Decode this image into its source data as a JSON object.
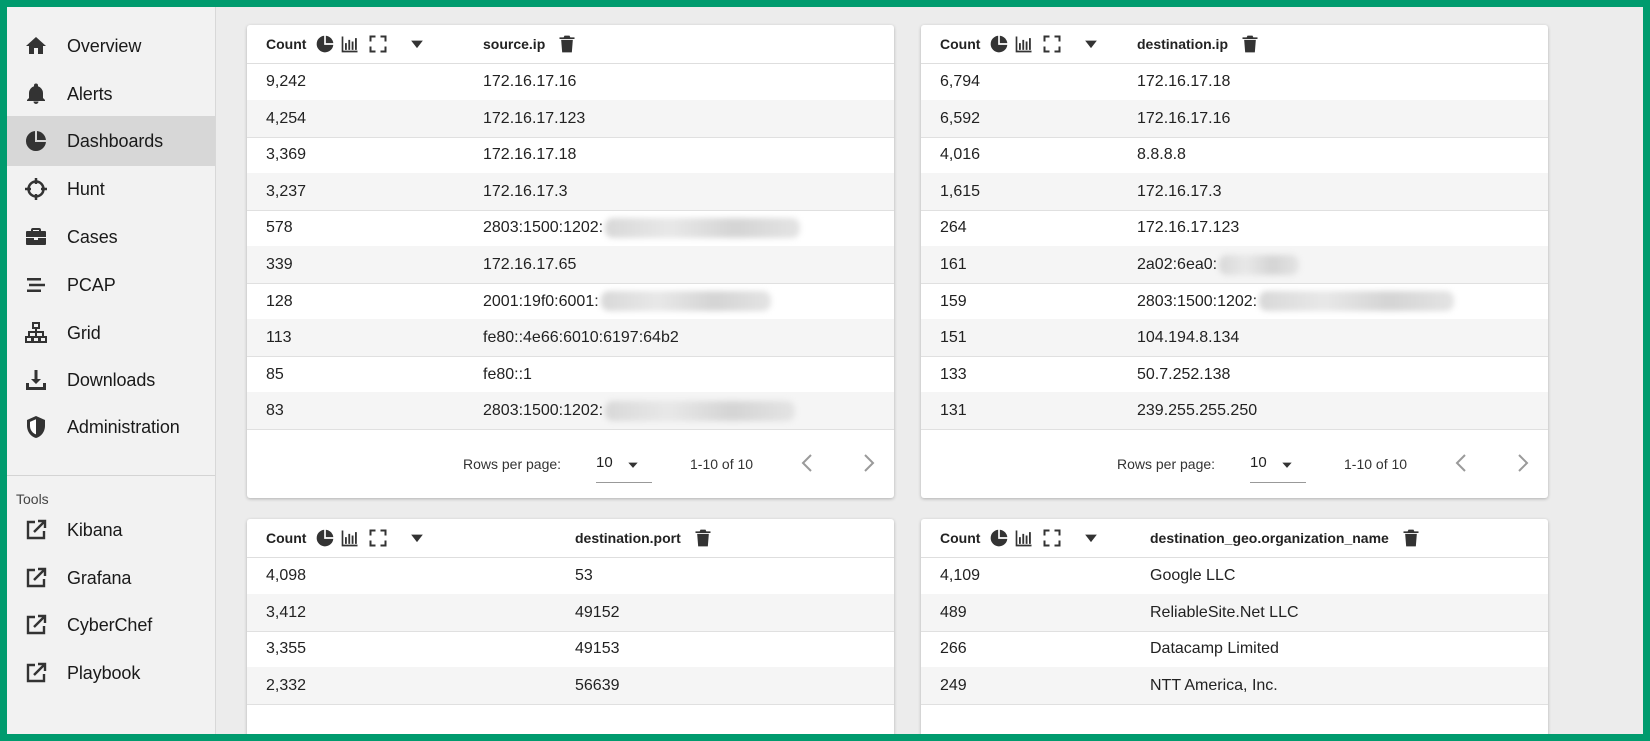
{
  "sidebar": {
    "nav": [
      {
        "label": "Overview",
        "icon": "home-icon",
        "active": false
      },
      {
        "label": "Alerts",
        "icon": "bell-icon",
        "active": false
      },
      {
        "label": "Dashboards",
        "icon": "pie-chart-icon",
        "active": true
      },
      {
        "label": "Hunt",
        "icon": "crosshairs-icon",
        "active": false
      },
      {
        "label": "Cases",
        "icon": "briefcase-icon",
        "active": false
      },
      {
        "label": "PCAP",
        "icon": "stream-icon",
        "active": false
      },
      {
        "label": "Grid",
        "icon": "sitemap-icon",
        "active": false
      },
      {
        "label": "Downloads",
        "icon": "download-icon",
        "active": false
      },
      {
        "label": "Administration",
        "icon": "shield-icon",
        "active": false
      }
    ],
    "tools_heading": "Tools",
    "tools": [
      {
        "label": "Kibana",
        "icon": "external-link-icon"
      },
      {
        "label": "Grafana",
        "icon": "external-link-icon"
      },
      {
        "label": "CyberChef",
        "icon": "external-link-icon"
      },
      {
        "label": "Playbook",
        "icon": "external-link-icon"
      }
    ]
  },
  "tables": [
    {
      "count_header": "Count",
      "field_header": "source.ip",
      "rows": [
        {
          "count": "9,242",
          "value": "172.16.17.16"
        },
        {
          "count": "4,254",
          "value": "172.16.17.123"
        },
        {
          "count": "3,369",
          "value": "172.16.17.18"
        },
        {
          "count": "3,237",
          "value": "172.16.17.3"
        },
        {
          "count": "578",
          "value": "2803:1500:1202:",
          "redacted": true
        },
        {
          "count": "339",
          "value": "172.16.17.65"
        },
        {
          "count": "128",
          "value": "2001:19f0:6001:",
          "redacted": true
        },
        {
          "count": "113",
          "value": "fe80::4e66:6010:6197:64b2"
        },
        {
          "count": "85",
          "value": "fe80::1"
        },
        {
          "count": "83",
          "value": "2803:1500:1202:",
          "redacted": true
        }
      ],
      "footer": {
        "rows_per_page_label": "Rows per page:",
        "rows_per_page": "10",
        "range": "1-10 of 10"
      }
    },
    {
      "count_header": "Count",
      "field_header": "destination.ip",
      "rows": [
        {
          "count": "6,794",
          "value": "172.16.17.18"
        },
        {
          "count": "6,592",
          "value": "172.16.17.16"
        },
        {
          "count": "4,016",
          "value": "8.8.8.8"
        },
        {
          "count": "1,615",
          "value": "172.16.17.3"
        },
        {
          "count": "264",
          "value": "172.16.17.123"
        },
        {
          "count": "161",
          "value": "2a02:6ea0:",
          "redacted": true
        },
        {
          "count": "159",
          "value": "2803:1500:1202:",
          "redacted": true
        },
        {
          "count": "151",
          "value": "104.194.8.134"
        },
        {
          "count": "133",
          "value": "50.7.252.138"
        },
        {
          "count": "131",
          "value": "239.255.255.250"
        }
      ],
      "footer": {
        "rows_per_page_label": "Rows per page:",
        "rows_per_page": "10",
        "range": "1-10 of 10"
      }
    },
    {
      "count_header": "Count",
      "field_header": "destination.port",
      "rows": [
        {
          "count": "4,098",
          "value": "53"
        },
        {
          "count": "3,412",
          "value": "49152"
        },
        {
          "count": "3,355",
          "value": "49153"
        },
        {
          "count": "2,332",
          "value": "56639"
        }
      ]
    },
    {
      "count_header": "Count",
      "field_header": "destination_geo.organization_name",
      "rows": [
        {
          "count": "4,109",
          "value": "Google LLC"
        },
        {
          "count": "489",
          "value": "ReliableSite.Net LLC"
        },
        {
          "count": "266",
          "value": "Datacamp Limited"
        },
        {
          "count": "249",
          "value": "NTT America, Inc."
        }
      ]
    }
  ]
}
